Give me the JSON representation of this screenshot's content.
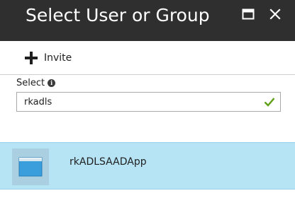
{
  "header": {
    "title": "Select User or Group"
  },
  "toolbar": {
    "invite_label": "Invite"
  },
  "select": {
    "label": "Select",
    "value": "rkadls"
  },
  "results": [
    {
      "name": "rkADLSAADApp"
    }
  ],
  "icons": {
    "maximize": "maximize-icon",
    "close": "close-icon",
    "invite": "plus-icon",
    "info": "info-icon",
    "valid": "checkmark-icon",
    "app": "application-icon"
  },
  "colors": {
    "header_bg": "#2f2f2f",
    "selected_row_bg": "#b6e4f5",
    "check": "#5ea015"
  }
}
